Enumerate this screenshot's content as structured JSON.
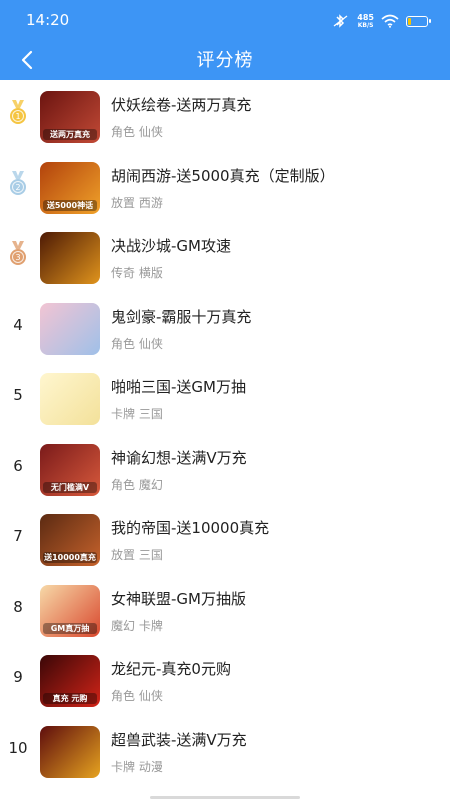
{
  "status_bar": {
    "time": "14:20",
    "net_speed_value": "485",
    "net_speed_unit": "KB/S",
    "icons": [
      "bluetooth-icon",
      "wifi-icon",
      "battery-icon"
    ]
  },
  "header": {
    "title": "评分榜",
    "back_icon": "chevron-left-icon"
  },
  "colors": {
    "header_bg": "#3d95f5",
    "gold": "#f5c542",
    "silver": "#a9cde6",
    "bronze": "#e0a070"
  },
  "games": [
    {
      "rank": "1",
      "medal": "gold",
      "name": "伏妖绘卷-送两万真充",
      "tags": "角色 仙侠",
      "thumb_text": "送两万真充",
      "thumb_colors": [
        "#6b1410",
        "#c24a36"
      ]
    },
    {
      "rank": "2",
      "medal": "silver",
      "name": "胡闹西游-送5000真充（定制版）",
      "tags": "放置 西游",
      "thumb_text": "送5000神话",
      "thumb_colors": [
        "#b2420c",
        "#f0a22a"
      ]
    },
    {
      "rank": "3",
      "medal": "bronze",
      "name": "决战沙城-GM攻速",
      "tags": "传奇 横版",
      "thumb_text": "",
      "thumb_colors": [
        "#4d1a05",
        "#e0941d"
      ]
    },
    {
      "rank": "4",
      "medal": "",
      "name": "鬼剑豪-霸服十万真充",
      "tags": "角色 仙侠",
      "thumb_text": "",
      "thumb_colors": [
        "#f2c4d3",
        "#9fc0e8"
      ]
    },
    {
      "rank": "5",
      "medal": "",
      "name": "啪啪三国-送GM万抽",
      "tags": "卡牌 三国",
      "thumb_text": "",
      "thumb_colors": [
        "#fff6cf",
        "#f3e19a"
      ]
    },
    {
      "rank": "6",
      "medal": "",
      "name": "神谕幻想-送满V万充",
      "tags": "角色 魔幻",
      "thumb_text": "无门槛满V",
      "thumb_colors": [
        "#7a1a1a",
        "#d85a3c"
      ]
    },
    {
      "rank": "7",
      "medal": "",
      "name": "我的帝国-送10000真充",
      "tags": "放置 三国",
      "thumb_text": "送10000真充",
      "thumb_colors": [
        "#5b2a12",
        "#c7632c"
      ]
    },
    {
      "rank": "8",
      "medal": "",
      "name": "女神联盟-GM万抽版",
      "tags": "魔幻 卡牌",
      "thumb_text": "GM真万抽",
      "thumb_colors": [
        "#f7d9a8",
        "#d9482e"
      ]
    },
    {
      "rank": "9",
      "medal": "",
      "name": "龙纪元-真充0元购",
      "tags": "角色 仙侠",
      "thumb_text": "真充 元购",
      "thumb_colors": [
        "#3a0707",
        "#d22418"
      ]
    },
    {
      "rank": "10",
      "medal": "",
      "name": "超兽武装-送满V万充",
      "tags": "卡牌 动漫",
      "thumb_text": "",
      "thumb_colors": [
        "#5e0d0d",
        "#e6a320"
      ]
    }
  ]
}
